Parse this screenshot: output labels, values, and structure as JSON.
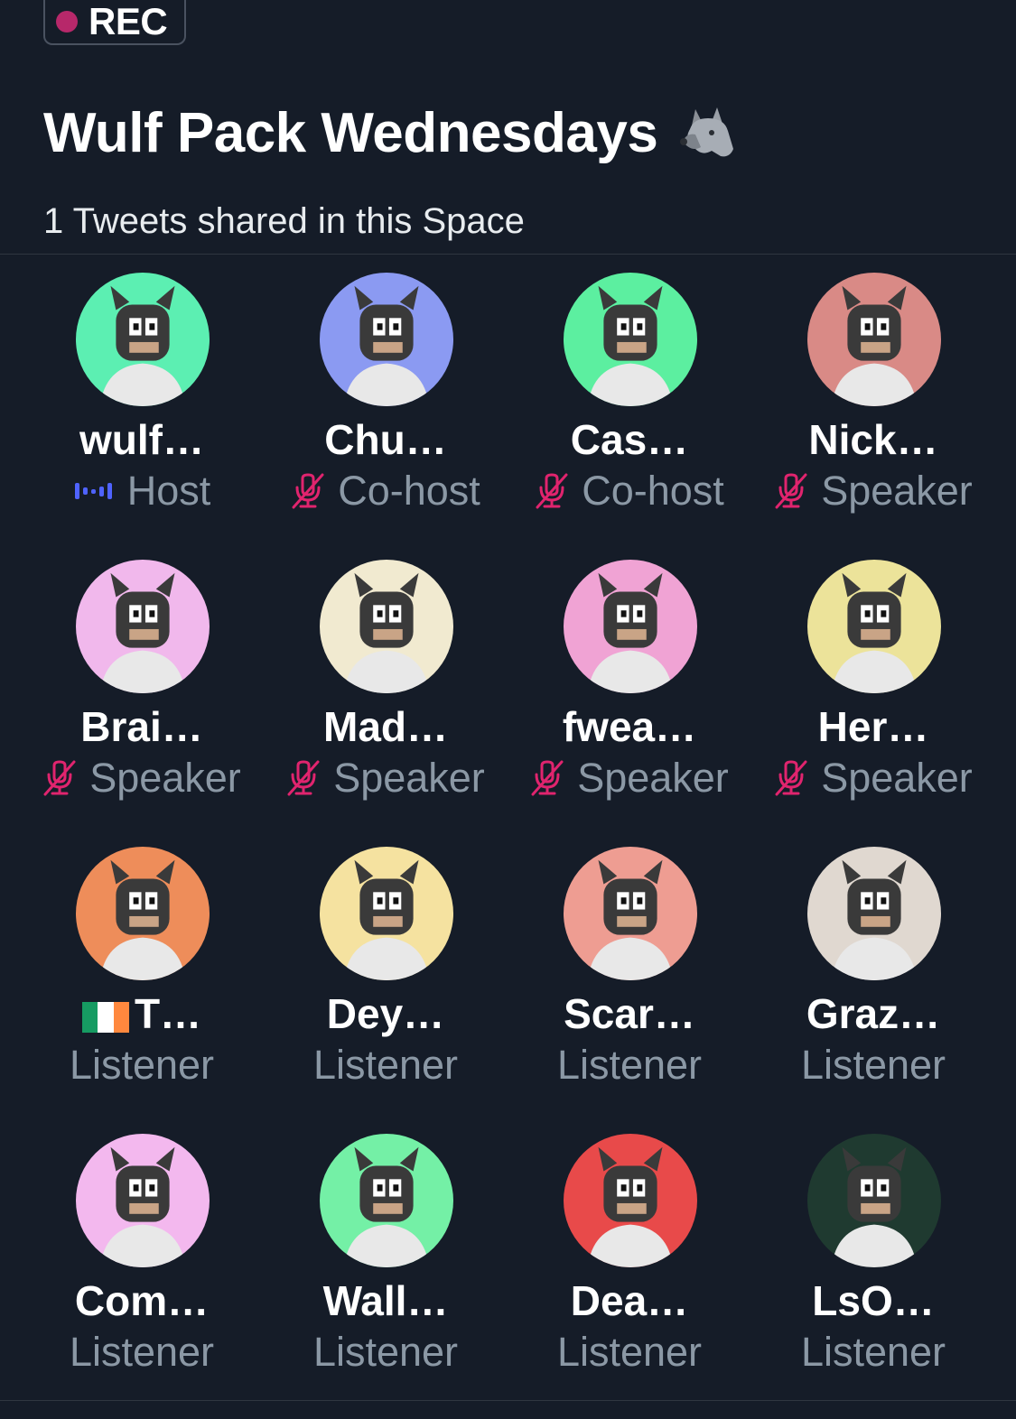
{
  "rec": {
    "label": "REC"
  },
  "space": {
    "title": "Wulf Pack Wednesdays",
    "title_icon": "wolf-emoji",
    "tweets_shared": "1 Tweets shared in this Space"
  },
  "colors": {
    "background": "#151c28",
    "rec_dot": "#b7286a",
    "muted_icon": "#e0246e",
    "live_indicator": "#4f63ff",
    "role_text": "#8b98a5"
  },
  "participants": [
    {
      "name": "wulf…",
      "role": "Host",
      "status": "live",
      "bg": "#5cefb2"
    },
    {
      "name": "Chu…",
      "role": "Co-host",
      "status": "muted",
      "bg": "#8b9af2"
    },
    {
      "name": "Cas…",
      "role": "Co-host",
      "status": "muted",
      "bg": "#5cefa0"
    },
    {
      "name": "Nick…",
      "role": "Speaker",
      "status": "muted",
      "bg": "#d98a86"
    },
    {
      "name": "Brai…",
      "role": "Speaker",
      "status": "muted",
      "bg": "#f1b8ec"
    },
    {
      "name": "Mad…",
      "role": "Speaker",
      "status": "muted",
      "bg": "#f1ead0"
    },
    {
      "name": "fwea…",
      "role": "Speaker",
      "status": "muted",
      "bg": "#f0a3d4"
    },
    {
      "name": "Her…",
      "role": "Speaker",
      "status": "muted",
      "bg": "#ece39a"
    },
    {
      "name": "T…",
      "flag": "ireland",
      "role": "Listener",
      "status": "none",
      "bg": "#ee8d5a"
    },
    {
      "name": "Dey…",
      "role": "Listener",
      "status": "none",
      "bg": "#f5e2a0"
    },
    {
      "name": "Scar…",
      "role": "Listener",
      "status": "none",
      "bg": "#ee9d92"
    },
    {
      "name": "Graz…",
      "role": "Listener",
      "status": "none",
      "bg": "#e0d8d0"
    },
    {
      "name": "Com…",
      "role": "Listener",
      "status": "none",
      "bg": "#f3b8ee"
    },
    {
      "name": "Wall…",
      "role": "Listener",
      "status": "none",
      "bg": "#74f0a6"
    },
    {
      "name": "Dea…",
      "role": "Listener",
      "status": "none",
      "bg": "#e84a4a"
    },
    {
      "name": "LsO…",
      "role": "Listener",
      "status": "none",
      "bg": "#1f3a30"
    }
  ]
}
